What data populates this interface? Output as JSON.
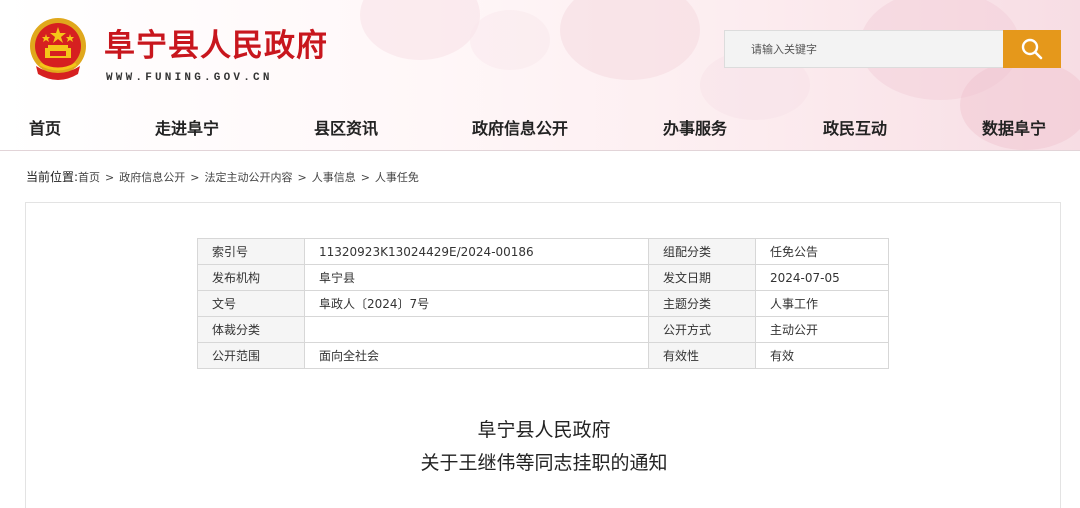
{
  "site": {
    "title": "阜宁县人民政府",
    "url": "WWW.FUNING.GOV.CN"
  },
  "search": {
    "placeholder": "请输入关键字",
    "icon": "search-icon"
  },
  "nav": {
    "items": [
      {
        "label": "首页"
      },
      {
        "label": "走进阜宁"
      },
      {
        "label": "县区资讯"
      },
      {
        "label": "政府信息公开"
      },
      {
        "label": "办事服务"
      },
      {
        "label": "政民互动"
      },
      {
        "label": "数据阜宁"
      }
    ]
  },
  "breadcrumb": {
    "lead": "当前位置:",
    "items": [
      "首页",
      "政府信息公开",
      "法定主动公开内容",
      "人事信息",
      "人事任免"
    ],
    "separator": ">"
  },
  "meta": {
    "rows": [
      {
        "k1": "索引号",
        "v1": "11320923K13024429E/2024-00186",
        "k2": "组配分类",
        "v2": "任免公告"
      },
      {
        "k1": "发布机构",
        "v1": "阜宁县",
        "k2": "发文日期",
        "v2": "2024-07-05"
      },
      {
        "k1": "文号",
        "v1": "阜政人〔2024〕7号",
        "k2": "主题分类",
        "v2": "人事工作"
      },
      {
        "k1": "体裁分类",
        "v1": "",
        "k2": "公开方式",
        "v2": "主动公开"
      },
      {
        "k1": "公开范围",
        "v1": "面向全社会",
        "k2": "有效性",
        "v2": "有效"
      }
    ]
  },
  "document": {
    "title_line1": "阜宁县人民政府",
    "title_line2": "关于王继伟等同志挂职的通知"
  },
  "colors": {
    "brand_red": "#c8161d",
    "search_orange": "#e5981b"
  }
}
